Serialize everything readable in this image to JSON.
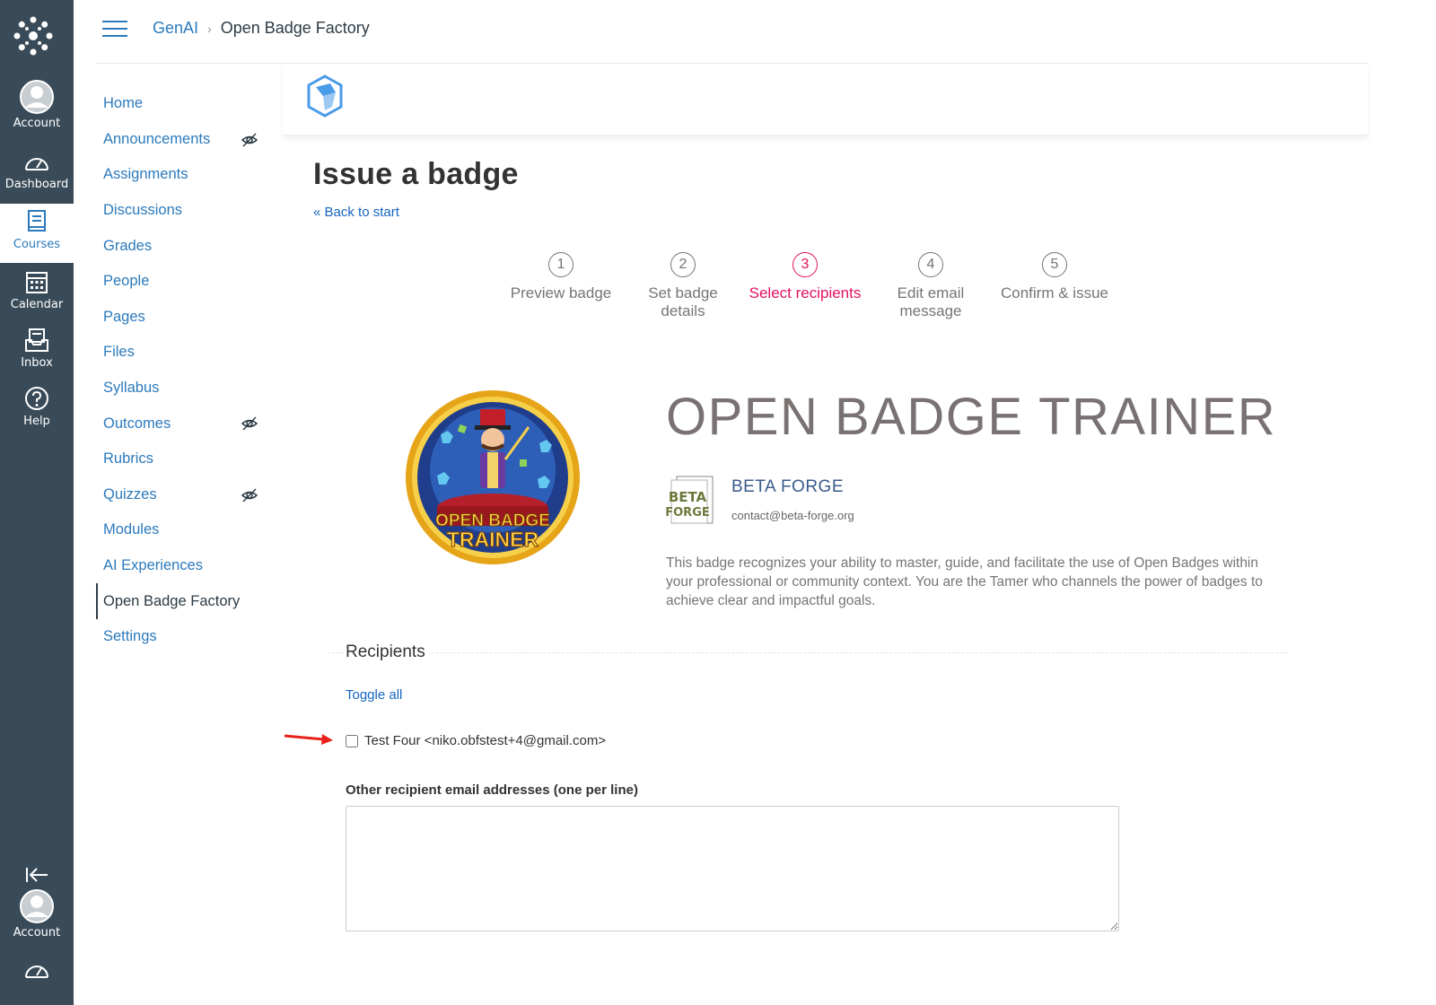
{
  "global_nav": {
    "items": [
      {
        "label": "Account",
        "icon": "account-icon"
      },
      {
        "label": "Dashboard",
        "icon": "dashboard-icon"
      },
      {
        "label": "Courses",
        "icon": "courses-icon",
        "active": true
      },
      {
        "label": "Calendar",
        "icon": "calendar-icon"
      },
      {
        "label": "Inbox",
        "icon": "inbox-icon"
      },
      {
        "label": "Help",
        "icon": "help-icon"
      }
    ],
    "bottom": {
      "account_label": "Account"
    },
    "colors": {
      "background": "#394b58",
      "active_text": "#2b7abc"
    }
  },
  "header": {
    "breadcrumb": {
      "course": "GenAI",
      "current": "Open Badge Factory"
    }
  },
  "course_nav": {
    "items": [
      {
        "label": "Home"
      },
      {
        "label": "Announcements",
        "hidden_icon": true
      },
      {
        "label": "Assignments"
      },
      {
        "label": "Discussions"
      },
      {
        "label": "Grades"
      },
      {
        "label": "People"
      },
      {
        "label": "Pages"
      },
      {
        "label": "Files"
      },
      {
        "label": "Syllabus"
      },
      {
        "label": "Outcomes",
        "hidden_icon": true
      },
      {
        "label": "Rubrics"
      },
      {
        "label": "Quizzes",
        "hidden_icon": true
      },
      {
        "label": "Modules"
      },
      {
        "label": "AI Experiences"
      },
      {
        "label": "Open Badge Factory",
        "active": true
      },
      {
        "label": "Settings"
      }
    ]
  },
  "tool": {
    "title": "Issue a badge",
    "back_link": "« Back to start",
    "steps": [
      {
        "num": "1",
        "label": "Preview badge"
      },
      {
        "num": "2",
        "label": "Set badge details"
      },
      {
        "num": "3",
        "label": "Select recipients",
        "active": true
      },
      {
        "num": "4",
        "label": "Edit email message"
      },
      {
        "num": "5",
        "label": "Confirm & issue"
      }
    ],
    "badge": {
      "name": "OPEN BADGE TRAINER",
      "image_text": "OPEN BADGE TRAINER",
      "issuer_name": "BETA FORGE",
      "issuer_logo_text": "BETA FORGE",
      "issuer_email": "contact@beta-forge.org",
      "description": "This badge recognizes your ability to master, guide, and facilitate the use of Open Badges within your professional or community context. You are the Tamer who channels the power of badges to achieve clear and impactful goals."
    },
    "recipients": {
      "legend": "Recipients",
      "toggle_all": "Toggle all",
      "list": [
        {
          "label": "Test Four <niko.obfstest+4@gmail.com>",
          "checked": false
        }
      ],
      "other_label": "Other recipient email addresses (one per line)",
      "other_value": ""
    },
    "colors": {
      "active_step": "#e0115f",
      "link": "#1565c0",
      "annotation_arrow": "#e8221b"
    }
  }
}
